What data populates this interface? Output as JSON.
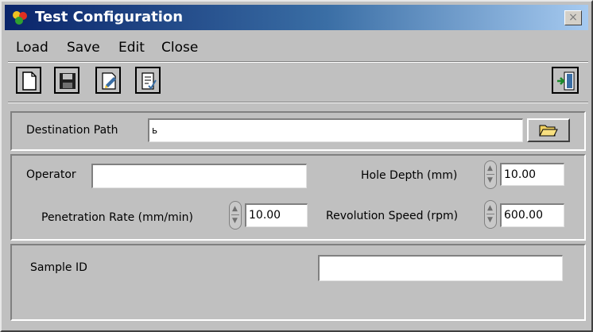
{
  "window": {
    "title": "Test Configuration",
    "close_glyph": "×"
  },
  "menu": {
    "items": [
      {
        "label": "Load"
      },
      {
        "label": "Save"
      },
      {
        "label": "Edit"
      },
      {
        "label": "Close"
      }
    ]
  },
  "toolbar": {
    "buttons": [
      {
        "icon": "new-document-icon"
      },
      {
        "icon": "save-disk-icon"
      },
      {
        "icon": "edit-document-icon"
      },
      {
        "icon": "check-document-icon"
      },
      {
        "icon": "exit-door-icon"
      }
    ]
  },
  "destination": {
    "label": "Destination Path",
    "value": "",
    "prefix_glyph": "ь"
  },
  "params": {
    "operator_label": "Operator",
    "operator_value": "",
    "hole_depth_label": "Hole Depth (mm)",
    "hole_depth_value": "10.00",
    "penetration_label": "Penetration Rate (mm/min)",
    "penetration_value": "10.00",
    "revolution_label": "Revolution Speed (rpm)",
    "revolution_value": "600.00"
  },
  "sample": {
    "label": "Sample ID",
    "value": ""
  },
  "colors": {
    "title_start": "#0a246a",
    "title_end": "#a6caf0",
    "face": "#c0c0c0"
  }
}
